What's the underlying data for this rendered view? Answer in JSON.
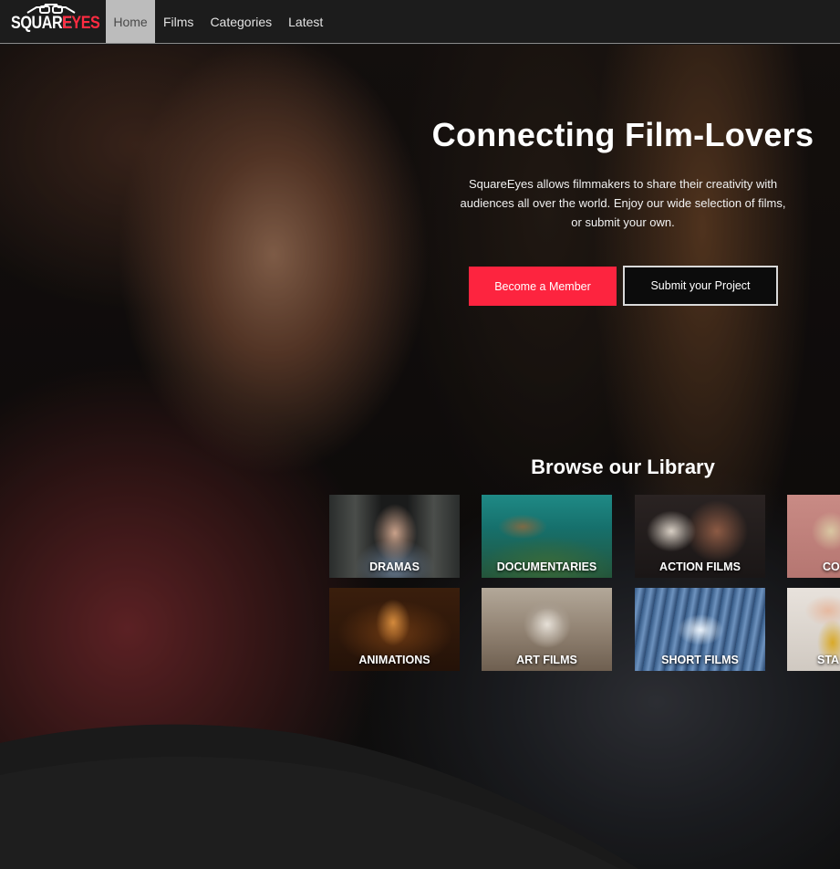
{
  "brand": {
    "logo_square": "SQUARE",
    "logo_eyes": "EYES",
    "accent_color": "#fd243f"
  },
  "nav": {
    "items": [
      {
        "label": "Home",
        "active": true
      },
      {
        "label": "Films",
        "active": false
      },
      {
        "label": "Categories",
        "active": false
      },
      {
        "label": "Latest",
        "active": false
      }
    ]
  },
  "hero": {
    "title": "Connecting Film-Lovers",
    "text": "SquareEyes allows filmmakers to share their creativity with audiences all over the world. Enjoy our wide selection of films, or submit your own.",
    "primary_button": "Become a Member",
    "secondary_button": "Submit your Project"
  },
  "library": {
    "title": "Browse our Library",
    "categories": [
      {
        "label": "DRAMAS"
      },
      {
        "label": "DOCUMENTARIES"
      },
      {
        "label": "ACTION FILMS"
      },
      {
        "label": "CO"
      },
      {
        "label": "ANIMATIONS"
      },
      {
        "label": "ART FILMS"
      },
      {
        "label": "SHORT FILMS"
      },
      {
        "label": "STA"
      }
    ]
  }
}
